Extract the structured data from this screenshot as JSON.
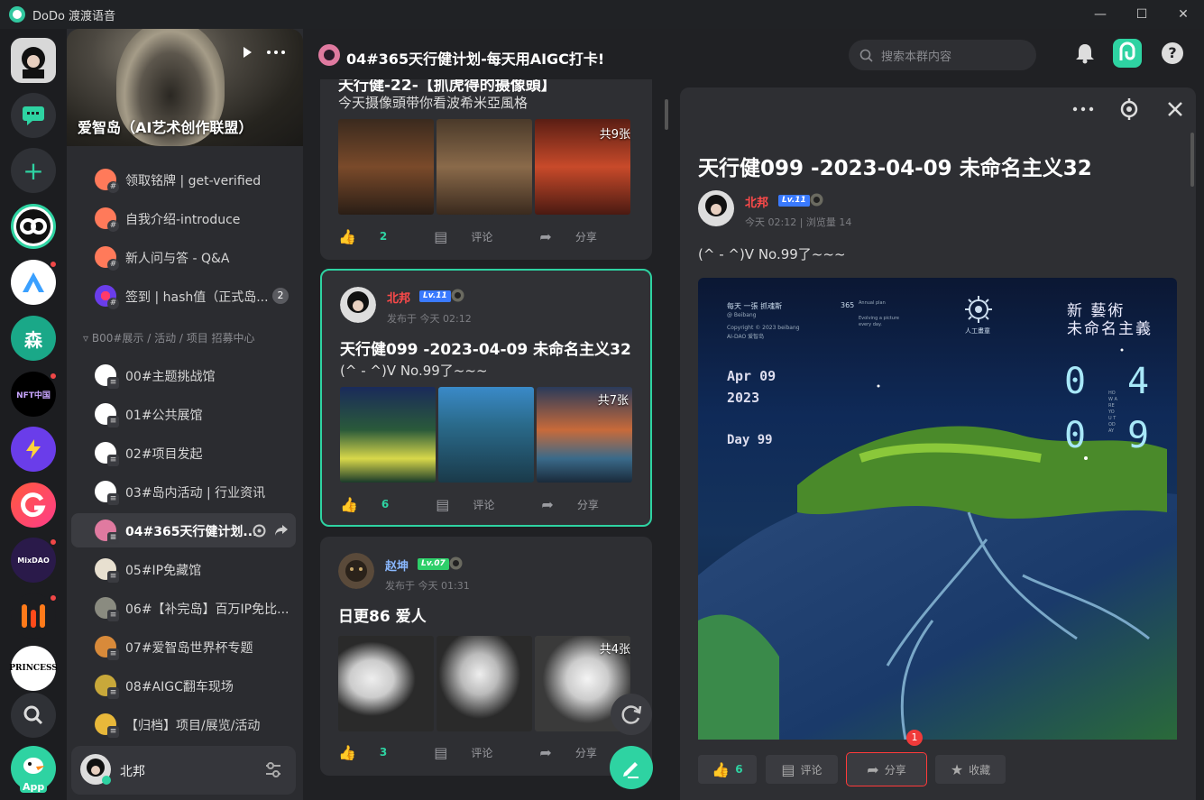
{
  "app": {
    "title": "DoDo 渡渡语音"
  },
  "window": {
    "minimize": "—",
    "maximize": "☐",
    "close": "✕"
  },
  "rail": {
    "new_label": "+",
    "app_label": "App",
    "princess_label": "PRINCESS",
    "nft_label": "NFT中国",
    "mix_label": "MixDAO",
    "forest_label": "森"
  },
  "server": {
    "name": "爱智岛（AI艺术创作联盟）",
    "channels_top": [
      {
        "label": "领取铭牌 | get-verified"
      },
      {
        "label": "自我介绍-introduce"
      },
      {
        "label": "新人问与答 - Q&A"
      },
      {
        "label": "签到 | hash值（正式岛...",
        "badge": "2"
      }
    ],
    "category": "B00#展示 / 活动 / 项目 招募中心",
    "channels": [
      {
        "label": "00#主题挑战馆"
      },
      {
        "label": "01#公共展馆"
      },
      {
        "label": "02#项目发起"
      },
      {
        "label": "03#岛内活动 | 行业资讯"
      },
      {
        "label": "04#365天行健计划..."
      },
      {
        "label": "05#IP免藏馆"
      },
      {
        "label": "06#【补完岛】百万IP免比..."
      },
      {
        "label": "07#爱智岛世界杯专题"
      },
      {
        "label": "08#AIGC翻车现场"
      },
      {
        "label": "【归档】项目/展览/活动"
      }
    ]
  },
  "user": {
    "name": "北邦"
  },
  "header": {
    "title": "04#365天行健计划-每天用AIGC打卡!",
    "search_placeholder": "搜索本群内容"
  },
  "feed": {
    "card1": {
      "title": "天行健-22-【抓虎得的摄像頭】",
      "subtitle": "今天摄像頭带你看波希米亞風格",
      "count": "共9张",
      "likes": "2",
      "comment": "评论",
      "share": "分享"
    },
    "card2": {
      "user": "北邦",
      "level": "Lv.11",
      "meta": "发布于 今天 02:12",
      "title": "天行健099 -2023-04-09 未命名主义32",
      "subtitle": "(^ - ^)V No.99了~~~",
      "count": "共7张",
      "likes": "6",
      "comment": "评论",
      "share": "分享"
    },
    "card3": {
      "user": "赵坤",
      "level": "Lv.07",
      "meta": "发布于 今天 01:31",
      "title": "日更86 爱人",
      "count": "共4张",
      "likes": "3",
      "comment": "评论",
      "share": "分享"
    }
  },
  "detail": {
    "title": "天行健099 -2023-04-09 未命名主义32",
    "user": "北邦",
    "level": "Lv.11",
    "meta": "今天 02:12 | 浏览量 14",
    "body": "(^ - ^)V No.99了~~~",
    "poster": {
      "top_left": "每天 一張 抓魂斯",
      "top_left_sub": "@ Beibang",
      "copyright": "Copyright © 2023 beibang",
      "copyright_sub": "AI-DAO 爱智岛",
      "top_mid": "365",
      "top_mid_sub": "Annual plan",
      "top_mid_sub2": "Evolving a picture every day.",
      "logo_text": "人工畫童",
      "title_cn": "新 藝術",
      "title_cn2": "未命名主義",
      "date": "Apr 09",
      "year": "2023",
      "day": "Day 99",
      "d1": "0",
      "d2": "4",
      "d3": "0",
      "d4": "9",
      "mini": "HOW ARE YOU TODAY"
    },
    "likes": "6",
    "comment": "评论",
    "share": "分享",
    "favorite": "收藏",
    "share_badge": "1"
  }
}
